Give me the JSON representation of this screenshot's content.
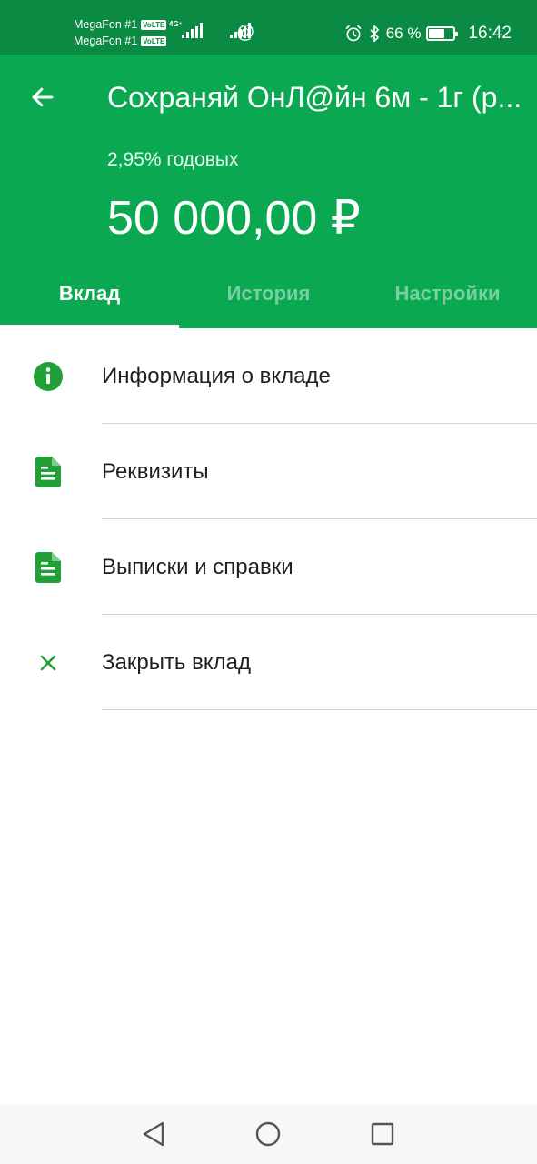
{
  "status_bar": {
    "carrier_1": "MegaFon #1",
    "carrier_2": "MegaFon #1",
    "volte_1": "VoLTE",
    "volte_2": "VoLTE",
    "network_type": "4G⁺",
    "battery_percent": "66 %",
    "battery_level": 0.66,
    "time": "16:42"
  },
  "header": {
    "title": "Сохраняй ОнЛ@йн 6м - 1г (р...",
    "rate": "2,95% годовых",
    "amount": "50 000,00 ₽"
  },
  "tabs": [
    {
      "label": "Вклад",
      "active": true
    },
    {
      "label": "История",
      "active": false
    },
    {
      "label": "Настройки",
      "active": false
    }
  ],
  "menu": [
    {
      "label": "Информация о вкладе",
      "icon": "info-icon"
    },
    {
      "label": "Реквизиты",
      "icon": "document-icon"
    },
    {
      "label": "Выписки и справки",
      "icon": "document-icon"
    },
    {
      "label": "Закрыть вклад",
      "icon": "close-icon"
    }
  ],
  "colors": {
    "status_bar": "#0a8a43",
    "brand_green": "#0aa851",
    "icon_green": "#21a038"
  }
}
